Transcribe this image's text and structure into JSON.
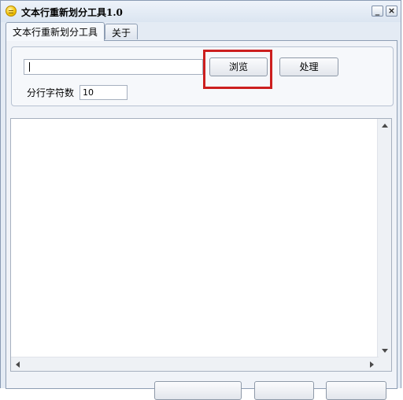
{
  "window": {
    "title": "文本行重新划分工具1.0",
    "minimize_label": "_",
    "close_label": "×"
  },
  "tabs": [
    {
      "label": "文本行重新划分工具",
      "active": true
    },
    {
      "label": "关于",
      "active": false
    }
  ],
  "form": {
    "path_value": "",
    "browse_label": "浏览",
    "process_label": "处理",
    "count_label": "分行字符数",
    "count_value": "10"
  },
  "output": {
    "text": ""
  },
  "colors": {
    "highlight": "#cc1f1f",
    "window_bg": "#e4ebf4"
  }
}
